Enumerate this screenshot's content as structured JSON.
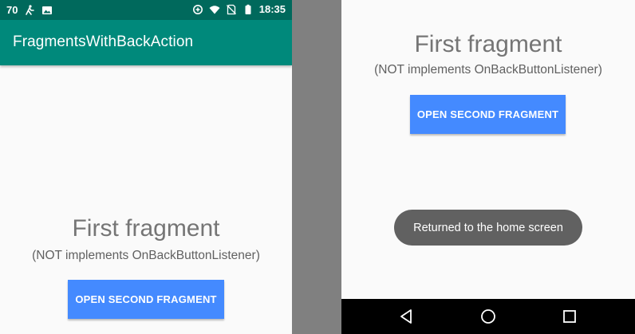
{
  "left_screen": {
    "status_bar": {
      "notification_count": "70",
      "time": "18:35",
      "left_icons": [
        "notification-count",
        "accessibility-icon",
        "image-icon"
      ],
      "right_icons": [
        "data-saver-icon",
        "wifi-icon",
        "no-sim-icon",
        "battery-icon"
      ]
    },
    "app_bar": {
      "title": "FragmentsWithBackAction"
    },
    "fragment": {
      "title": "First fragment",
      "subtitle": "(NOT implements OnBackButtonListener)",
      "button_label": "OPEN SECOND FRAGMENT"
    }
  },
  "right_screen": {
    "fragment": {
      "title": "First fragment",
      "subtitle": "(NOT implements OnBackButtonListener)",
      "button_label": "OPEN SECOND FRAGMENT"
    },
    "toast": "Returned to the home screen",
    "nav_bar": {
      "icons": [
        "back-icon",
        "home-icon",
        "recents-icon"
      ]
    }
  },
  "colors": {
    "status_bar": "#00695c",
    "app_bar": "#00897b",
    "button": "#448aff",
    "toast": "#616161",
    "separator": "#808080"
  }
}
